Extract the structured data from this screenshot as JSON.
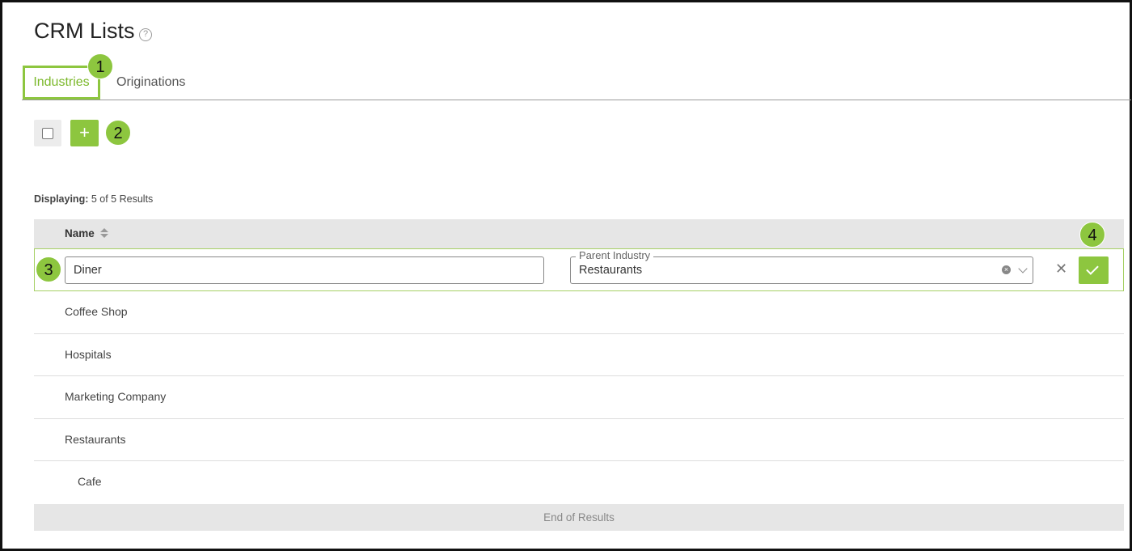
{
  "page": {
    "title": "CRM Lists",
    "help_icon": "?"
  },
  "tabs": [
    {
      "label": "Industries",
      "active": true
    },
    {
      "label": "Originations",
      "active": false
    }
  ],
  "toolbar": {
    "add_label": "+"
  },
  "callouts": [
    "1",
    "2",
    "3",
    "4"
  ],
  "results": {
    "prefix": "Displaying:",
    "count_text": "5 of 5 Results"
  },
  "table": {
    "columns": [
      {
        "label": "Name",
        "sortable": true
      }
    ],
    "edit_row": {
      "name_value": "Diner",
      "parent_label": "Parent Industry",
      "parent_value": "Restaurants"
    },
    "rows": [
      {
        "name": "Coffee Shop",
        "level": 0
      },
      {
        "name": "Hospitals",
        "level": 0
      },
      {
        "name": "Marketing Company",
        "level": 0
      },
      {
        "name": "Restaurants",
        "level": 0
      },
      {
        "name": "Cafe",
        "level": 1
      }
    ],
    "footer": "End of Results"
  },
  "colors": {
    "accent": "#8dc63f",
    "header_bg": "#e6e6e6"
  }
}
